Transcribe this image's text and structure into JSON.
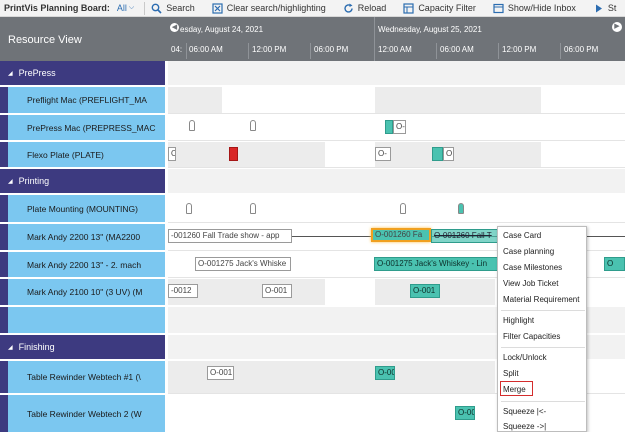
{
  "toolbar": {
    "title": "PrintVis Planning Board:",
    "filter_value": "All",
    "buttons": [
      {
        "label": "Search",
        "icon": "search-icon"
      },
      {
        "label": "Clear search/highlighting",
        "icon": "clear-highlight-icon"
      },
      {
        "label": "Reload",
        "icon": "reload-icon"
      },
      {
        "label": "Capacity Filter",
        "icon": "capacity-filter-icon"
      },
      {
        "label": "Show/Hide Inbox",
        "icon": "inbox-icon"
      },
      {
        "label": "St",
        "icon": "play-icon"
      }
    ]
  },
  "left_panel": {
    "header": "Resource View",
    "groups": [
      "PrePress",
      "Printing",
      "Finishing"
    ],
    "resources": [
      "Preflight Mac (PREFLIGHT_MA",
      "PrePress Mac (PREPRESS_MAC",
      "Flexo Plate (PLATE)",
      "Plate Mounting (MOUNTING)",
      "Mark Andy 2200 13\" (MA2200",
      "Mark Andy 2200 13\" - 2. mach",
      "Mark Andy 2100 10\" (3 UV) (M",
      "Table Rewinder Webtech #1 (\\",
      "Table Rewinder Webtech 2 (W"
    ]
  },
  "timeline": {
    "days": [
      "esday, August 24, 2021",
      "Wednesday, August 25, 2021"
    ],
    "hours": [
      "04:",
      "06:00 AM",
      "12:00 PM",
      "06:00 PM",
      "12:00 AM",
      "06:00 AM",
      "12:00 PM",
      "06:00 PM"
    ]
  },
  "jobs": {
    "mark_andy_1_left": "-001260 Fall Trade show - app",
    "mark_andy_1_selected": "O-001260 Fa",
    "mark_andy_1_ghost": "O-001260 Fall T",
    "mark_andy_2_left": "O-001275 Jack's Whiske",
    "mark_andy_2_right": "O-001275 Jack's Whiskey - Lin",
    "mark_andy_2_far": "O",
    "mark_andy_3_a": "-0012",
    "mark_andy_3_b": "O-001",
    "mark_andy_3_c": "O-001",
    "rewinder_1_a": "O-001",
    "rewinder_1_b": "O-00",
    "rewinder_2_a": "O-00",
    "prepress_a": "O-",
    "flexo_a": "O-",
    "flexo_b": "O-",
    "flexo_c": "O"
  },
  "context_menu": {
    "items": [
      "Case Card",
      "Case planning",
      "Case Milestones",
      "View Job Ticket",
      "Material Requirement",
      "Highlight",
      "Filter Capacities",
      "Lock/Unlock",
      "Split",
      "Merge",
      "Squeeze |<-",
      "Squeeze ->|"
    ],
    "highlighted_item": "Merge"
  },
  "colors": {
    "header_gray": "#6f7378",
    "group_purple": "#3d3a80",
    "resource_blue": "#7bc7f0",
    "job_teal": "#4ac2b0",
    "job_red": "#d92626",
    "selection_orange": "#f0a020",
    "merge_outline_red": "#d42c2c"
  }
}
